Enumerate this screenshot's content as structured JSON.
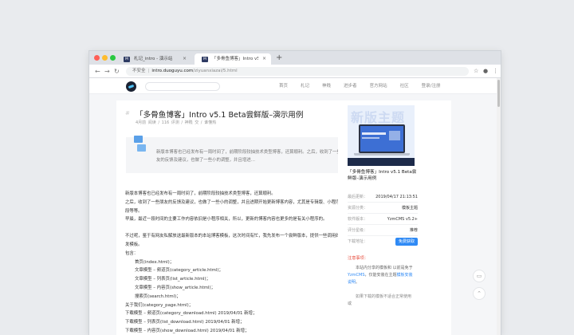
{
  "browser": {
    "tabs": [
      {
        "favicon": "M",
        "label": "札记_intro - 演示站"
      },
      {
        "favicon": "M",
        "label": "「多骨鱼博客」Intro v5.1 Beta尝"
      }
    ],
    "new_tab_icon": "plus-icon",
    "nav": {
      "back": "←",
      "forward": "→",
      "reload": "↻"
    },
    "security_label": "不安全",
    "url_host": "intro.duoguyu.com",
    "url_path": "/ziyuanxiazai/5.html"
  },
  "site": {
    "search_placeholder": "",
    "menu": [
      "首页",
      "札记",
      "神贱",
      "进步者",
      "官方网站",
      "社区",
      "登录/注册"
    ]
  },
  "article": {
    "title": "「多骨鱼博客」Intro v5.1 Beta尝鲜版–演示用例",
    "title_tag": "/ 资源下载",
    "meta": "4月前  阅读 / 116  评测 / 神贱  交 / 谁懂热",
    "summary": "新版本博客也已经发布有一周时间了，前期阶段较抽技术类型博客，还算顺利。之后，收到了一些朋友的反馈及建议，也做了一些小的调整，并且增进…",
    "body": {
      "p1": "新版本博客也已经发布有一周时间了，前期阶段较抽技术类型博客，还算顺利。",
      "p2": "之后，收到了一些朋友的反馈及建议，也做了一些小的调整，并且进期开始更新博客内容，尤其是专辑版、小程序、代码段等等。",
      "p3": "早晨，最近一段时间的主要工作内容依旧是小程序相关，所以，更新的博客内容也更多的是有关小程序的。",
      "p4": "不过呢，鉴于有网友私解放送最新版本的本站博客模板，这次时间有忙，我先发布一个尝鲜版本，提供一些调用好目及开发模板。",
      "p5": "包含：",
      "items": [
        "首页(index.html)；",
        "文章模型 – 频道页(category_article.html)；",
        "文章模型 – 列表页(list_article.html)；",
        "文章模型 – 内容页(show_article.html)；",
        "搜索页(search.html)；",
        "关于我们(category_page.html)；",
        "下载模型 – 频道页(category_download.html)  2019/04/01 新增；",
        "下载模型 – 列表页(list_download.html)  2019/04/01 新增；",
        "下载模型 – 内容页(show_download.html)  2019/04/01 新增；"
      ]
    }
  },
  "sidebar": {
    "cover_text": "新版主题",
    "title": "「多骨鱼博客」Intro v5.1 Beta尝鲜版–演示用例",
    "rows": [
      {
        "k": "最后更新：",
        "v": "2019/04/17 21:13:51"
      },
      {
        "k": "资源分类：",
        "v": "模板主题"
      },
      {
        "k": "软件版本：",
        "v": "YzmCMS v5.2+"
      },
      {
        "k": "评分星级：",
        "v": "推荐"
      },
      {
        "k": "下载地址：",
        "v": "免费获取"
      }
    ]
  },
  "notice": {
    "title": "注意事项：",
    "text_before": "本站内分享的模板和 以前是免于",
    "link1": "YzmCMS",
    "text_mid": "，仅能安装在主题",
    "link2": "模板安装说明",
    "text_after": "。",
    "text2": "如果下载的模板不适合正常使用或"
  },
  "float_buttons": [
    "chat-icon",
    "arrow-up-icon"
  ]
}
